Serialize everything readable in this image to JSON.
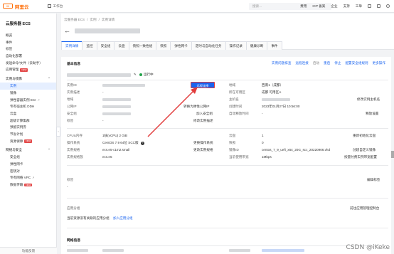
{
  "topbar": {
    "brand": "阿里云",
    "workspace": "工作台",
    "search_placeholder": "搜索...",
    "links": [
      "费用",
      "ICP 备案",
      "企业",
      "支持",
      "工单"
    ]
  },
  "sidebar": {
    "title": "云服务器 ECS",
    "items_top": [
      "概览",
      "事件",
      "标签",
      "自动化部署",
      "发送命令/文件（云助手）",
      "应用管理"
    ],
    "group1": "实例与镜像",
    "group1_items": [
      "实例",
      "镜像",
      "弹性容器实例 ECI",
      "专有宿主机 DDH",
      "云盒",
      "超级计算集群",
      "预留实例券",
      "节省计划",
      "资源保障"
    ],
    "group2": "网络与安全",
    "group2_items": [
      "安全组",
      "弹性网卡",
      "密钥对",
      "专有网络 VPC",
      "数据传输"
    ],
    "bottom": "功能反馈"
  },
  "header": {
    "breadcrumb": [
      "云服务器 ECS",
      "/",
      "实例",
      "/",
      "实例详情"
    ],
    "tabs": [
      "实例详情",
      "监控",
      "安全组",
      "云盘",
      "快照一致性组",
      "快照",
      "弹性网卡",
      "定时与自动化任务",
      "操作记录",
      "健康诊断",
      "事件"
    ]
  },
  "basic_info": {
    "title": "基本信息",
    "status": "运行中",
    "actions": [
      "实例问题排查",
      "远程连接",
      "启动",
      "重启",
      "停止",
      "配置安全组规则",
      "更多操作"
    ],
    "remote_button": "远程连接",
    "left_labels": [
      "实例ID",
      "实例描述",
      "地域",
      "公网IP",
      "安全组",
      "标签"
    ],
    "left_values": [
      "",
      "-",
      "",
      "",
      "",
      "-"
    ],
    "left_links": [
      "",
      "",
      "",
      "转换为弹性公网IP",
      "加入安全组",
      "修改实例描述"
    ],
    "right_labels": [
      "地域",
      "所在可用区",
      "主机名",
      "创建时间",
      "自动释放时间"
    ],
    "right_values": [
      "西南1（成都）",
      "成都 可用区A",
      "",
      "2023年01月27日 10:56:00",
      "-"
    ],
    "right_links": [
      "",
      "",
      "修改实例主机名",
      "",
      "释放设置"
    ]
  },
  "config_info": {
    "left_labels": [
      "CPU&内存",
      "操作系统",
      "实例规格",
      "实例规格族"
    ],
    "left_values": [
      "1核(vCPU) 2 GiB",
      "CentOS 7.9 64位 SCC版",
      "ecs.e5-c1m2.small",
      "ecs.e5"
    ],
    "left_links": [
      "",
      "更换操作系统",
      "更改实例规格",
      ""
    ],
    "mid_labels": [
      "云盘",
      "快照",
      "镜像ID",
      "当前使用带宽"
    ],
    "mid_values": [
      "1",
      "0",
      "centos_7_9_uefi_x64_20G_scc_20220906.vhd",
      "1Mbps"
    ],
    "right_links": [
      "重新初始化云盘",
      "",
      "创建自定义镜像",
      "按量付费实例带宽配置"
    ]
  },
  "tags_section": {
    "title": "标签",
    "value": "-",
    "edit": "编辑标签"
  },
  "app_group": {
    "title": "应用分组",
    "desc": "当前资源没有关联的应用分组",
    "link": "加入应用分组",
    "manage": "前往应用管理控制台"
  },
  "network_section": {
    "title": "网络信息"
  },
  "watermark": "CSDN @iKeke"
}
